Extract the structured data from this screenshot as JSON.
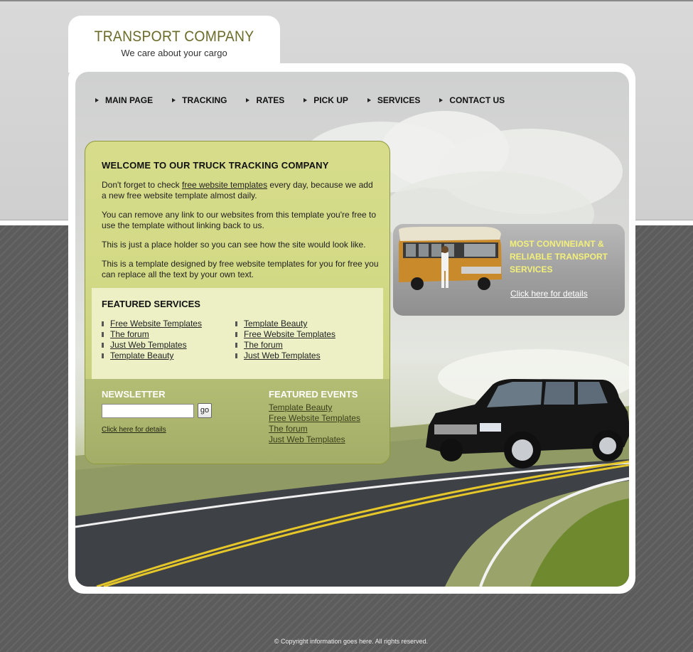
{
  "logo": {
    "title": "TRANSPORT COMPANY",
    "slogan": "We care about your cargo"
  },
  "nav": {
    "items": [
      "MAIN PAGE",
      "TRACKING",
      "RATES",
      "PICK UP",
      "SERVICES",
      "CONTACT US"
    ]
  },
  "welcome": {
    "title": "WELCOME TO OUR TRUCK TRACKING COMPANY",
    "p1_before": "Don't forget to check ",
    "p1_link": "free website templates",
    "p1_after": " every day, because we add a new free website template almost daily.",
    "p2": "You can remove any link to our websites from this template you're free to use the template without linking back to us.",
    "p3": "This is just a place holder so you can see how the site would look like.",
    "p4": "This is a template designed by free website templates for you for free you can replace all the text by your own text."
  },
  "featured": {
    "title": "FEATURED SERVICES",
    "left": [
      "Free Website Templates",
      "The forum",
      "Just Web Templates",
      "Template Beauty"
    ],
    "right": [
      "Template Beauty",
      "Free Website Templates",
      "The forum",
      "Just Web Templates"
    ]
  },
  "newsletter": {
    "title": "NEWSLETTER",
    "input_value": "",
    "go_label": "go",
    "link": "Click here for details"
  },
  "events": {
    "title": "FEATURED EVENTS",
    "items": [
      "Template Beauty",
      "Free Website Templates",
      "The forum",
      "Just Web Templates"
    ]
  },
  "promo": {
    "text": "MOST CONVINEIANT & RELIABLE TRANSPORT SERVICES",
    "link": "Click here for details"
  },
  "footer": {
    "copyright": "© Copyright information goes here. All rights reserved."
  },
  "colors": {
    "panel_green": "#d6dc8a",
    "featured_bg": "#ecf0c4",
    "promo_text": "#f3f07a",
    "logo_title": "#6b6b2a"
  }
}
